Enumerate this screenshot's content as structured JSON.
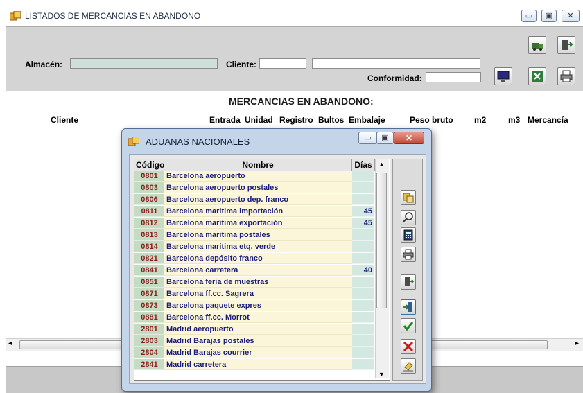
{
  "main": {
    "title": "LISTADOS DE MERCANCIAS EN ABANDONO",
    "almacen_label": "Almacén:",
    "almacen_value": "",
    "cliente_label": "Cliente:",
    "cliente_code": "",
    "cliente_name": "",
    "conformidad_label": "Conformidad:",
    "conformidad_value": "",
    "report_title": "MERCANCIAS EN ABANDONO:",
    "columns": [
      "Cliente",
      "Entrada",
      "Unidad",
      "Registro",
      "Bultos",
      "Embalaje",
      "Peso bruto",
      "m2",
      "m3",
      "Mercancía"
    ]
  },
  "modal": {
    "title": "ADUANAS NACIONALES",
    "headers": {
      "codigo": "Código",
      "nombre": "Nombre",
      "dias": "Días"
    },
    "rows": [
      {
        "code": "0801",
        "name": "Barcelona aeropuerto",
        "dias": ""
      },
      {
        "code": "0803",
        "name": "Barcelona aeropuerto postales",
        "dias": ""
      },
      {
        "code": "0806",
        "name": "Barcelona aeropuerto dep. franco",
        "dias": ""
      },
      {
        "code": "0811",
        "name": "Barcelona maritima importación",
        "dias": "45"
      },
      {
        "code": "0812",
        "name": "Barcelona maritima exportación",
        "dias": "45"
      },
      {
        "code": "0813",
        "name": "Barcelona maritima postales",
        "dias": ""
      },
      {
        "code": "0814",
        "name": "Barcelona maritima etq. verde",
        "dias": ""
      },
      {
        "code": "0821",
        "name": "Barcelona depósito franco",
        "dias": ""
      },
      {
        "code": "0841",
        "name": "Barcelona carretera",
        "dias": "40"
      },
      {
        "code": "0851",
        "name": "Barcelona feria de muestras",
        "dias": ""
      },
      {
        "code": "0871",
        "name": "Barcelona ff.cc. Sagrera",
        "dias": ""
      },
      {
        "code": "0873",
        "name": "Barcelona paquete expres",
        "dias": ""
      },
      {
        "code": "0881",
        "name": "Barcelona ff.cc. Morrot",
        "dias": ""
      },
      {
        "code": "2801",
        "name": "Madrid aeropuerto",
        "dias": ""
      },
      {
        "code": "2803",
        "name": "Madrid Barajas postales",
        "dias": ""
      },
      {
        "code": "2804",
        "name": "Madrid Barajas courrier",
        "dias": ""
      },
      {
        "code": "2841",
        "name": "Madrid carretera",
        "dias": ""
      }
    ]
  },
  "colors": {
    "code_bg": "#c5dcc3",
    "code_text": "#8c1c1c",
    "name_bg": "#fbf6da",
    "name_text": "#1a1c7a",
    "modal_frame": "#c4d5ea"
  },
  "icons": {
    "main_toolbar": [
      "truck-icon",
      "exit-door-icon",
      "monitor-icon",
      "excel-icon",
      "printer-icon"
    ],
    "modal_side": [
      "copy-icon",
      "search-icon",
      "calculator-icon",
      "printer-icon",
      "exit-door-icon",
      "import-icon",
      "checkmark-icon",
      "cancel-x-icon",
      "eraser-icon"
    ]
  }
}
